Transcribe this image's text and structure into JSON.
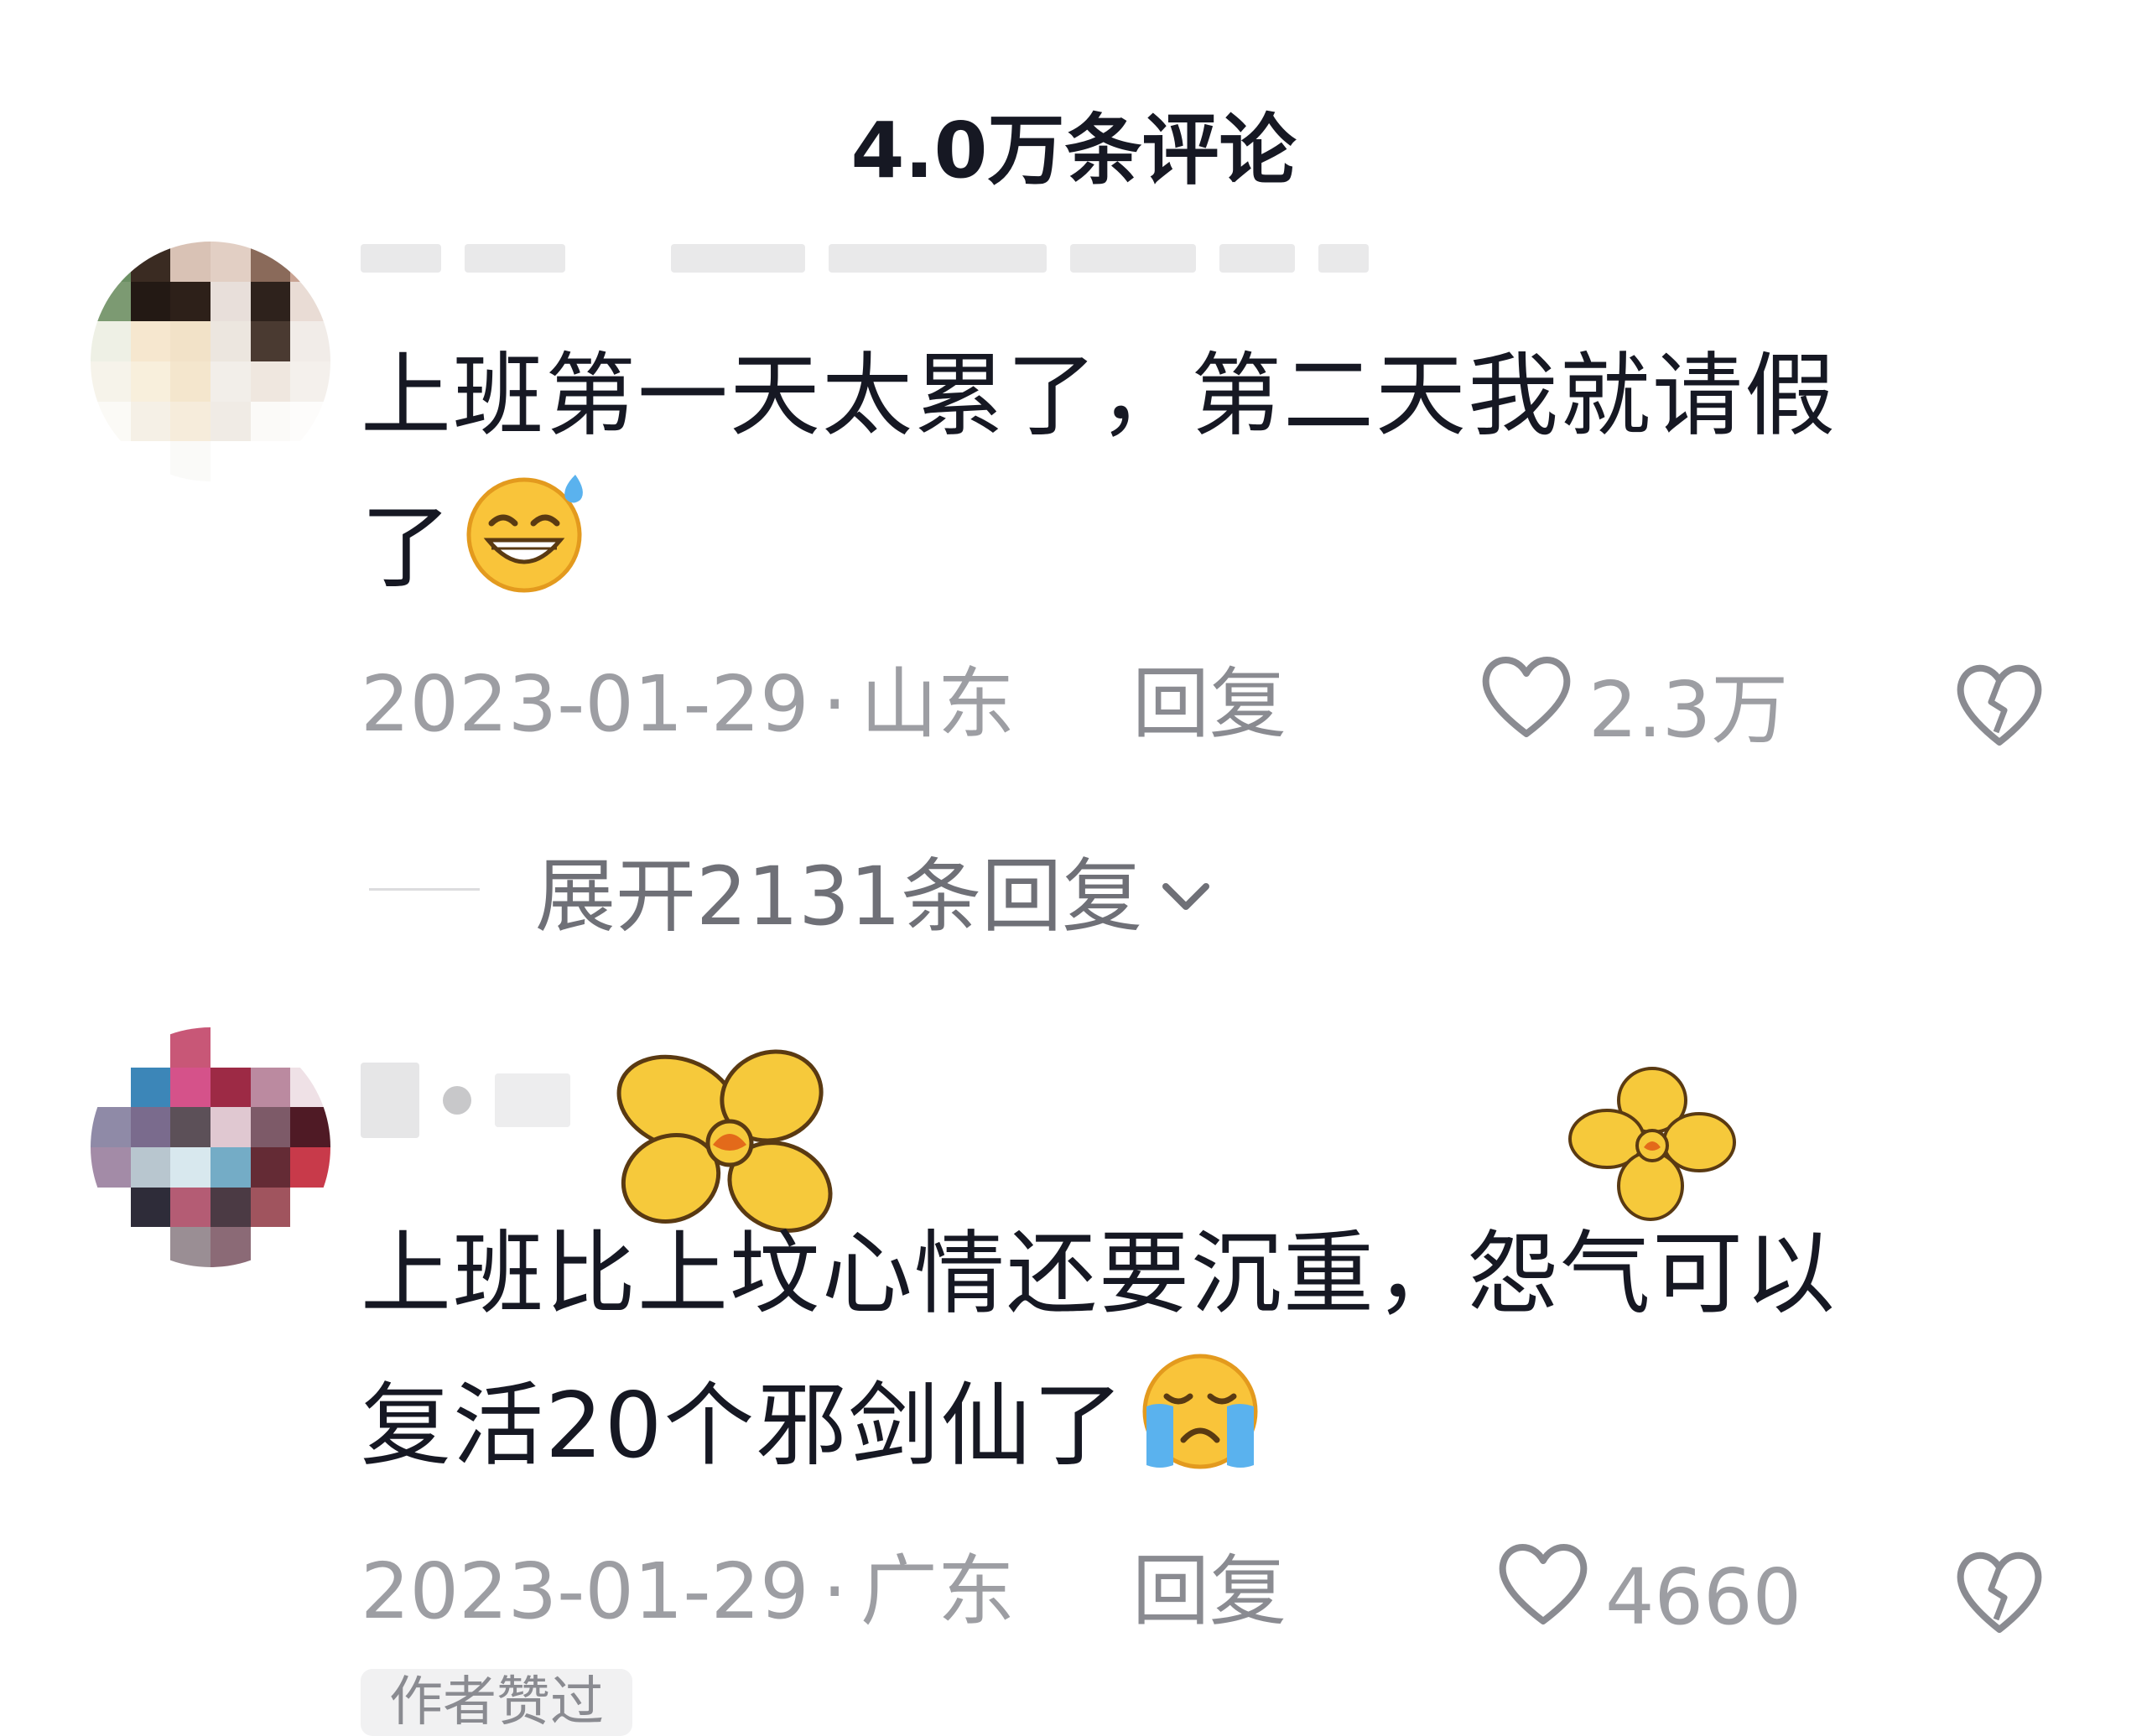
{
  "header": {
    "title": "4.0万条评论"
  },
  "comments": [
    {
      "text_line1": "上班第一天太累了，第二天我就请假",
      "text_line2": "了",
      "emoji": "sweat-smile-emoji",
      "date": "2023-01-29",
      "separator": "·",
      "location": "山东",
      "reply_label": "回复",
      "likes": "2.3万",
      "expand_label": "展开2131条回复"
    },
    {
      "text_line1": "上班比上坟心情还要沉重，怨气可以",
      "text_line2": "复活20个邪剑仙了",
      "emoji": "loudly-crying-emoji",
      "date": "2023-01-29",
      "separator": "·",
      "location": "广东",
      "reply_label": "回复",
      "likes": "4660"
    }
  ],
  "author_tag": "作者赞过",
  "icons": {
    "like": "heart-outline-icon",
    "dislike": "broken-heart-icon",
    "expand": "chevron-down-icon",
    "sticker": "yellow-flower-sticker"
  },
  "colors": {
    "text": "#161823",
    "meta": "#9d9ea3",
    "flower": "#f6c93b"
  }
}
